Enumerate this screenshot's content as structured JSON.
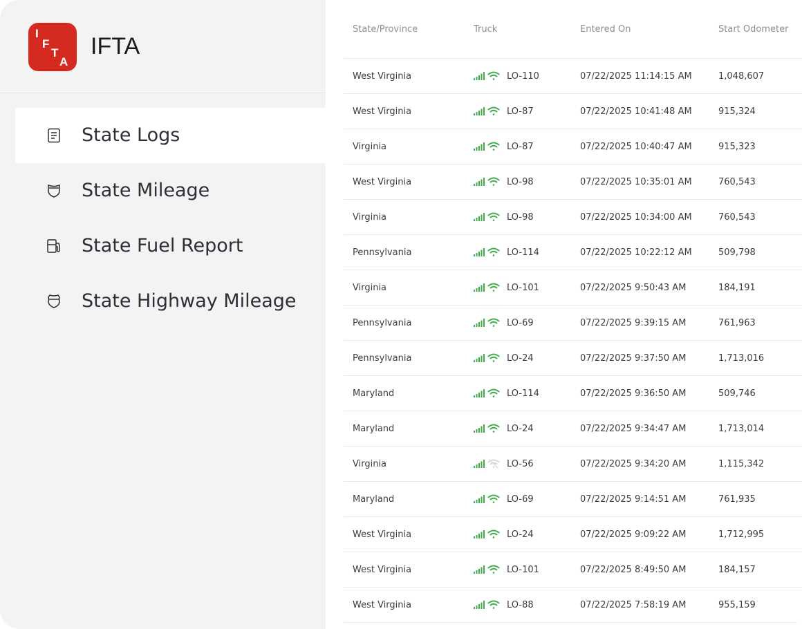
{
  "app": {
    "title": "IFTA",
    "logo_letters": [
      "I",
      "F",
      "T",
      "A"
    ]
  },
  "nav": {
    "items": [
      {
        "label": "State Logs",
        "icon": "document-icon",
        "active": true
      },
      {
        "label": "State Mileage",
        "icon": "shield-icon",
        "active": false
      },
      {
        "label": "State Fuel Report",
        "icon": "fuel-pump-icon",
        "active": false
      },
      {
        "label": "State Highway Mileage",
        "icon": "highway-shield-icon",
        "active": false
      }
    ]
  },
  "table": {
    "headers": [
      "State/Province",
      "Truck",
      "Entered On",
      "Start Odometer"
    ],
    "rows": [
      {
        "state": "West Virginia",
        "truck": "LO-110",
        "entered": "07/22/2025 11:14:15 AM",
        "odometer": "1,048,607",
        "wifi_online": true
      },
      {
        "state": "West Virginia",
        "truck": "LO-87",
        "entered": "07/22/2025 10:41:48 AM",
        "odometer": "915,324",
        "wifi_online": true
      },
      {
        "state": "Virginia",
        "truck": "LO-87",
        "entered": "07/22/2025 10:40:47 AM",
        "odometer": "915,323",
        "wifi_online": true
      },
      {
        "state": "West Virginia",
        "truck": "LO-98",
        "entered": "07/22/2025 10:35:01 AM",
        "odometer": "760,543",
        "wifi_online": true
      },
      {
        "state": "Virginia",
        "truck": "LO-98",
        "entered": "07/22/2025 10:34:00 AM",
        "odometer": "760,543",
        "wifi_online": true
      },
      {
        "state": "Pennsylvania",
        "truck": "LO-114",
        "entered": "07/22/2025 10:22:12 AM",
        "odometer": "509,798",
        "wifi_online": true
      },
      {
        "state": "Virginia",
        "truck": "LO-101",
        "entered": "07/22/2025 9:50:43 AM",
        "odometer": "184,191",
        "wifi_online": true
      },
      {
        "state": "Pennsylvania",
        "truck": "LO-69",
        "entered": "07/22/2025 9:39:15 AM",
        "odometer": "761,963",
        "wifi_online": true
      },
      {
        "state": "Pennsylvania",
        "truck": "LO-24",
        "entered": "07/22/2025 9:37:50 AM",
        "odometer": "1,713,016",
        "wifi_online": true
      },
      {
        "state": "Maryland",
        "truck": "LO-114",
        "entered": "07/22/2025 9:36:50 AM",
        "odometer": "509,746",
        "wifi_online": true
      },
      {
        "state": "Maryland",
        "truck": "LO-24",
        "entered": "07/22/2025 9:34:47 AM",
        "odometer": "1,713,014",
        "wifi_online": true
      },
      {
        "state": "Virginia",
        "truck": "LO-56",
        "entered": "07/22/2025 9:34:20 AM",
        "odometer": "1,115,342",
        "wifi_online": false
      },
      {
        "state": "Maryland",
        "truck": "LO-69",
        "entered": "07/22/2025 9:14:51 AM",
        "odometer": "761,935",
        "wifi_online": true
      },
      {
        "state": "West Virginia",
        "truck": "LO-24",
        "entered": "07/22/2025 9:09:22 AM",
        "odometer": "1,712,995",
        "wifi_online": true
      },
      {
        "state": "West Virginia",
        "truck": "LO-101",
        "entered": "07/22/2025 8:49:50 AM",
        "odometer": "184,157",
        "wifi_online": true
      },
      {
        "state": "West Virginia",
        "truck": "LO-88",
        "entered": "07/22/2025 7:58:19 AM",
        "odometer": "955,159",
        "wifi_online": true
      }
    ]
  },
  "colors": {
    "brand": "#d42a1f",
    "signal_green": "#3fae49",
    "wifi_offline": "#d9d9d9",
    "sidebar_bg": "#f3f3f3"
  }
}
